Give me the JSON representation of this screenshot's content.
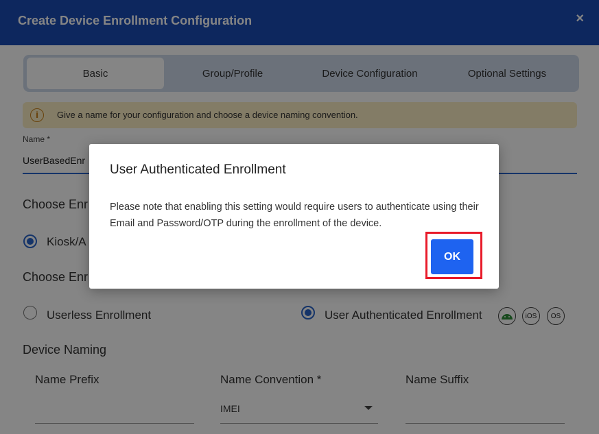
{
  "header": {
    "title": "Create Device Enrollment Configuration",
    "close_icon": "×"
  },
  "tabs": [
    {
      "label": "Basic",
      "active": true
    },
    {
      "label": "Group/Profile",
      "active": false
    },
    {
      "label": "Device Configuration",
      "active": false
    },
    {
      "label": "Optional Settings",
      "active": false
    }
  ],
  "info": {
    "icon": "i",
    "text": "Give a name for your configuration and choose a device naming convention."
  },
  "name_field": {
    "label": "Name *",
    "value": "UserBasedEnr"
  },
  "enrollment_mode": {
    "title": "Choose Enr",
    "kiosk_label": "Kiosk/A"
  },
  "enrollment_type": {
    "title": "Choose Enr",
    "userless_label": "Userless Enrollment",
    "user_auth_label": "User Authenticated Enrollment",
    "os_icons": [
      {
        "name": "android-icon",
        "text": ""
      },
      {
        "name": "ios-icon",
        "text": "iOS"
      },
      {
        "name": "macos-icon",
        "text": "OS"
      }
    ]
  },
  "device_naming": {
    "title": "Device Naming",
    "prefix_label": "Name Prefix",
    "convention_label": "Name Convention *",
    "convention_value": "IMEI",
    "suffix_label": "Name Suffix"
  },
  "dialog": {
    "title": "User Authenticated Enrollment",
    "message": "Please note that enabling this setting would require users to authenticate using their Email and Password/OTP during the enrollment of the device.",
    "ok_label": "OK"
  },
  "colors": {
    "header": "#1a4bb5",
    "accent": "#1e63f0",
    "highlight": "#e81b2a"
  }
}
